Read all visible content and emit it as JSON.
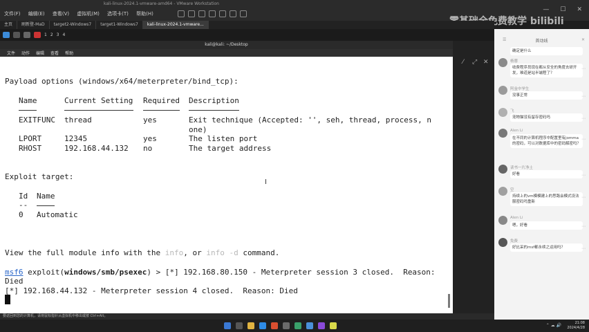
{
  "vmware": {
    "title": "kali-linux-2024.1-vmware-amd64 - VMware Workstation",
    "menus": [
      "文件(F)",
      "编辑(E)",
      "查看(V)",
      "虚拟机(M)",
      "选项卡(T)",
      "帮助(H)"
    ],
    "tabs": [
      "主页",
      "刷新登-MaD",
      "target2-Windows7",
      "target1-Windows7",
      "kali-linux-2024.1-vmware..."
    ],
    "status": "要返回到您的计算机，请将鼠标指针从虚拟机中移出或按 Ctrl+Alt。"
  },
  "kali_panel": {
    "workspaces": [
      "1",
      "2",
      "3",
      "4"
    ]
  },
  "terminal": {
    "title": "kali@kali: ~/Desktop",
    "menus": [
      "文件",
      "动作",
      "编辑",
      "查看",
      "帮助"
    ],
    "lines": {
      "payload_header": "Payload options (windows/x64/meterpreter/bind_tcp):",
      "col_name": "Name",
      "col_setting": "Current Setting",
      "col_required": "Required",
      "col_desc": "Description",
      "r1_name": "EXITFUNC",
      "r1_setting": "thread",
      "r1_required": "yes",
      "r1_desc": "Exit technique (Accepted: '', seh, thread, process, n",
      "r1_desc2": "one)",
      "r2_name": "LPORT",
      "r2_setting": "12345",
      "r2_required": "yes",
      "r2_desc": "The listen port",
      "r3_name": "RHOST",
      "r3_setting": "192.168.44.132",
      "r3_required": "no",
      "r3_desc": "The target address",
      "exploit_header": "Exploit target:",
      "col_id": "Id",
      "id_dash": "--",
      "t_id": "0",
      "t_name": "Automatic",
      "info_a": "View the full module info with the ",
      "info_cmd1": "info",
      "info_b": ", or ",
      "info_cmd2": "info -d",
      "info_c": " command.",
      "prompt_msf": "msf6",
      "prompt_ex": " exploit(",
      "prompt_mod": "windows/smb/psexec",
      "prompt_end": ") > [*] 192.168.80.150 - Meterpreter session 3 closed.  Reason:",
      "died": "Died",
      "last": "[*] 192.168.44.132 - Meterpreter session 4 closed.  Reason: Died"
    }
  },
  "watermark": "零基础全免费教学 bilibili",
  "chat": {
    "header": "首动线",
    "messages": [
      {
        "user": "",
        "text": "确定是什么"
      },
      {
        "user": "杨蓉",
        "text": "收费程序员现在都从安全的角度去研开发，难道是站半端程了？"
      },
      {
        "user": "阿金中学生",
        "text": "没事正常"
      },
      {
        "user": "飞",
        "text": "宠物猫没有留存密码吗"
      },
      {
        "user": "Alen Li",
        "text": "在不同的计算机程序中配置里有jomma的密码，可以对数据库中的密码解密吗？"
      },
      {
        "user": "读书一片净土",
        "text": "好看"
      },
      {
        "user": "空",
        "text": "持续上的vm模模建上的思路会模式设法服密码吗重新"
      },
      {
        "user": "Alen Li",
        "text": "嗯，好看"
      },
      {
        "user": "免费",
        "text": "好比采的msf都永续之运用吗？"
      }
    ]
  },
  "clock": {
    "time": "21:08",
    "date": "2024/4/28"
  }
}
